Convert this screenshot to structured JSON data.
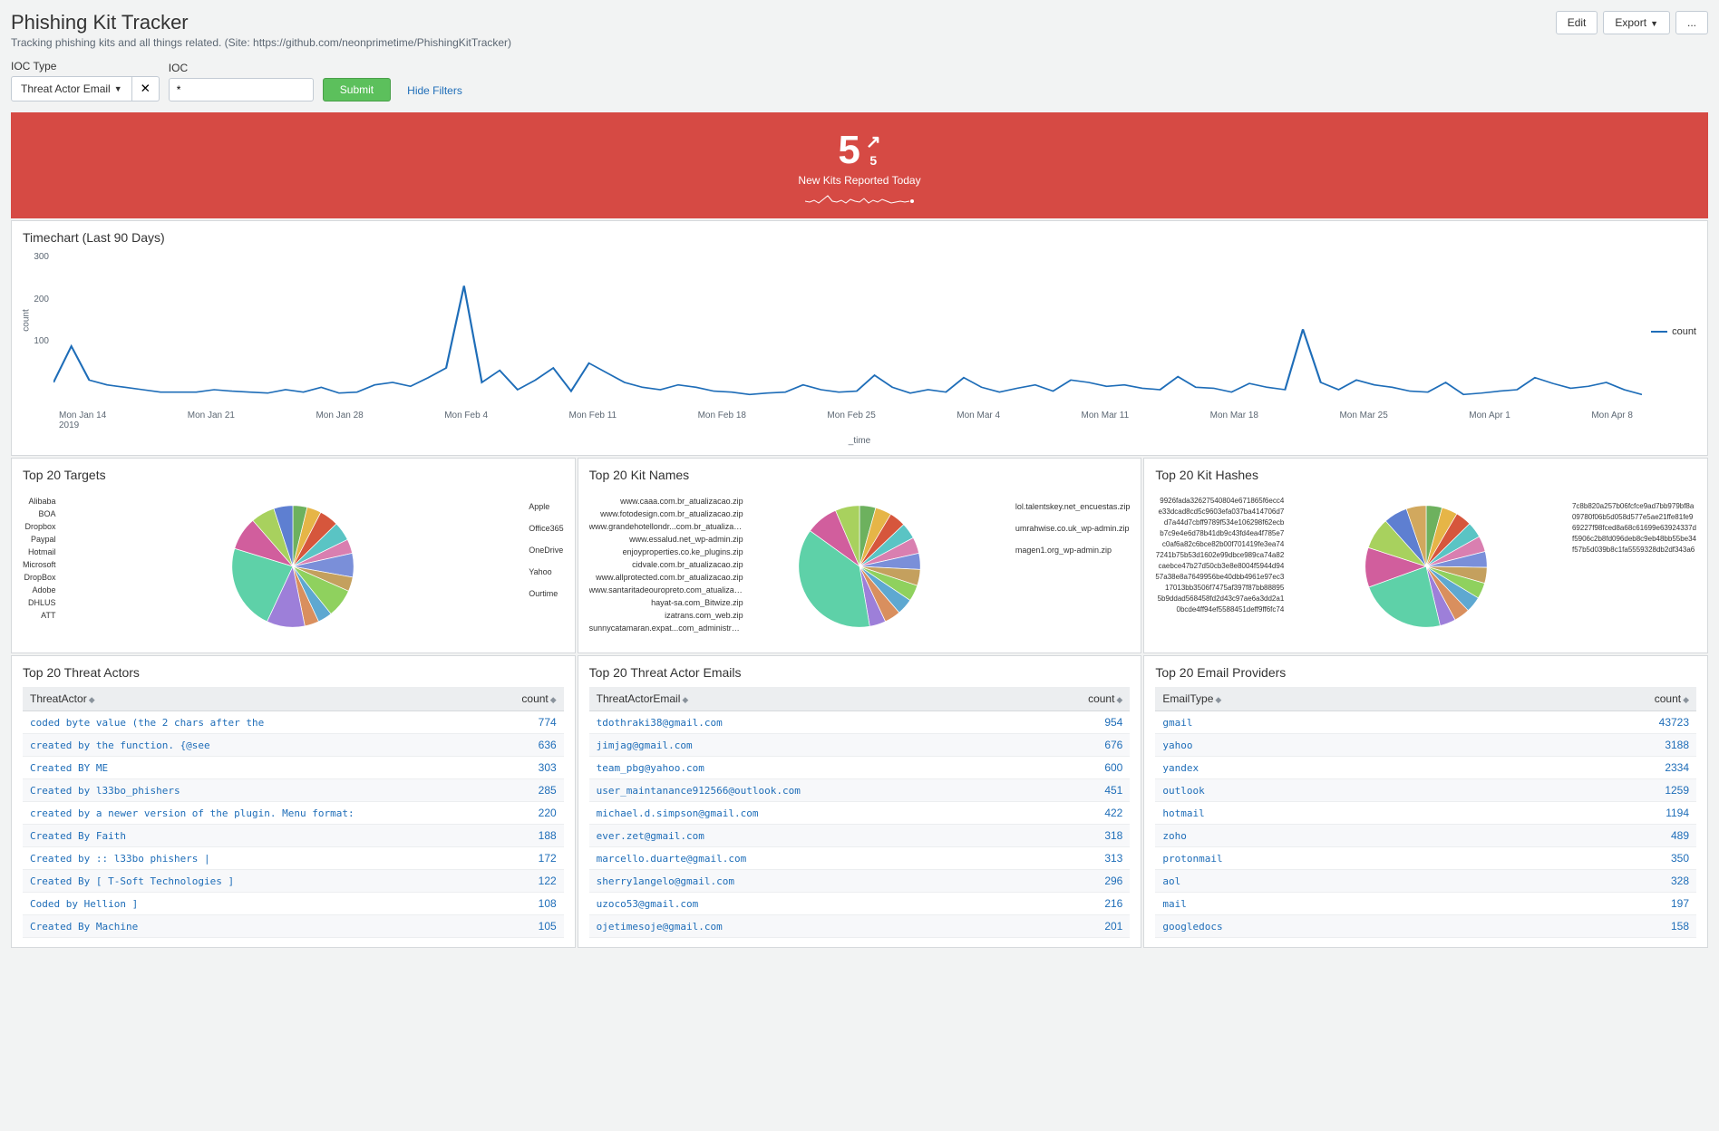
{
  "header": {
    "title": "Phishing Kit Tracker",
    "subtitle": "Tracking phishing kits and all things related. (Site: https://github.com/neonprimetime/PhishingKitTracker)",
    "buttons": {
      "edit": "Edit",
      "export": "Export",
      "more": "..."
    }
  },
  "filters": {
    "ioc_type_label": "IOC Type",
    "ioc_type_value": "Threat Actor Email",
    "ioc_label": "IOC",
    "ioc_value": "*",
    "submit": "Submit",
    "hide_filters": "Hide Filters"
  },
  "banner": {
    "value": "5",
    "delta": "5",
    "label": "New Kits Reported Today"
  },
  "timechart": {
    "title": "Timechart (Last 90 Days)",
    "y_label": "count",
    "y_ticks": [
      "300",
      "200",
      "100"
    ],
    "x_label": "_time",
    "x_ticks": [
      "Mon Jan 14",
      "Mon Jan 21",
      "Mon Jan 28",
      "Mon Feb 4",
      "Mon Feb 11",
      "Mon Feb 18",
      "Mon Feb 25",
      "Mon Mar 4",
      "Mon Mar 11",
      "Mon Mar 18",
      "Mon Mar 25",
      "Mon Apr 1",
      "Mon Apr 8"
    ],
    "x_year": "2019",
    "legend": "count"
  },
  "pies": {
    "targets": {
      "title": "Top 20 Targets",
      "left": [
        "Alibaba",
        "BOA",
        "Dropbox",
        "Paypal",
        "Hotmail",
        "Microsoft",
        "DropBox",
        "Adobe",
        "DHLUS",
        "ATT"
      ],
      "right": [
        "Apple",
        "Office365",
        "OneDrive",
        "Yahoo",
        "Ourtime"
      ]
    },
    "kitnames": {
      "title": "Top 20 Kit Names",
      "left": [
        "www.caaa.com.br_atualizacao.zip",
        "www.fotodesign.com.br_atualizacao.zip",
        "www.grandehotellondr...com.br_atualizacao.zip",
        "www.essalud.net_wp-admin.zip",
        "enjoyproperties.co.ke_plugins.zip",
        "cidvale.com.br_atualizacao.zip",
        "www.allprotected.com.br_atualizacao.zip",
        "www.santaritadeouropreto.com_atualizacao.zip",
        "hayat-sa.com_Bitwize.zip",
        "izatrans.com_web.zip",
        "sunnycatamaran.expat...com_administrator.zip"
      ],
      "right": [
        "lol.talentskey.net_encuestas.zip",
        "umrahwise.co.uk_wp-admin.zip",
        "magen1.org_wp-admin.zip"
      ]
    },
    "hashes": {
      "title": "Top 20 Kit Hashes",
      "left": [
        "9926fada32627540804e671865f6ecc4",
        "e33dcad8cd5c9603efa037ba414706d7",
        "d7a44d7cbff9789f534e106298f62ecb",
        "b7c9e4e6d78b41db9c43fd4ea4f785e7",
        "c0af6a82c6bce82b00f701419fe3ea74",
        "7241b75b53d1602e99dbce989ca74a82",
        "caebce47b27d50cb3e8e8004f5944d94",
        "57a38e8a7649956be40dbb4961e97ec3",
        "17013bb3506f7475af397f87bb88895",
        "5b9ddad568458fd2d43c97ae6a3dd2a1",
        "0bcde4ff94ef5588451deff9ff6fc74"
      ],
      "right": [
        "7c8b820a257b06fcfce9ad7bb979bf8a",
        "09780f06b5d058d577e5ae21ffe81fe9",
        "69227f98fced8a68c61699e63924337d",
        "f5906c2b8fd096deb8c9eb48bb55be34",
        "f57b5d039b8c1fa5559328db2df343a6"
      ]
    }
  },
  "tables": {
    "actors": {
      "title": "Top 20 Threat Actors",
      "col1": "ThreatActor",
      "col2": "count",
      "rows": [
        {
          "a": "coded byte value (the 2 chars after the",
          "c": "774"
        },
        {
          "a": "created by the function. {@see",
          "c": "636"
        },
        {
          "a": "Created BY ME",
          "c": "303"
        },
        {
          "a": "Created by l33bo_phishers",
          "c": "285"
        },
        {
          "a": "created by a newer version of the plugin. Menu format:",
          "c": "220"
        },
        {
          "a": "Created By Faith",
          "c": "188"
        },
        {
          "a": "Created by :: l33bo phishers   |",
          "c": "172"
        },
        {
          "a": "Created By [ T-Soft Technologies ]",
          "c": "122"
        },
        {
          "a": "Coded by Hellion ]",
          "c": "108"
        },
        {
          "a": "Created By Machine",
          "c": "105"
        }
      ]
    },
    "emails": {
      "title": "Top 20 Threat Actor Emails",
      "col1": "ThreatActorEmail",
      "col2": "count",
      "rows": [
        {
          "a": "tdothraki38@gmail.com",
          "c": "954"
        },
        {
          "a": "jimjag@gmail.com",
          "c": "676"
        },
        {
          "a": "team_pbg@yahoo.com",
          "c": "600"
        },
        {
          "a": "user_maintanance912566@outlook.com",
          "c": "451"
        },
        {
          "a": "michael.d.simpson@gmail.com",
          "c": "422"
        },
        {
          "a": "ever.zet@gmail.com",
          "c": "318"
        },
        {
          "a": "marcello.duarte@gmail.com",
          "c": "313"
        },
        {
          "a": "sherry1angelo@gmail.com",
          "c": "296"
        },
        {
          "a": "uzoco53@gmail.com",
          "c": "216"
        },
        {
          "a": "ojetimesoje@gmail.com",
          "c": "201"
        }
      ]
    },
    "providers": {
      "title": "Top 20 Email Providers",
      "col1": "EmailType",
      "col2": "count",
      "rows": [
        {
          "a": "gmail",
          "c": "43723"
        },
        {
          "a": "yahoo",
          "c": "3188"
        },
        {
          "a": "yandex",
          "c": "2334"
        },
        {
          "a": "outlook",
          "c": "1259"
        },
        {
          "a": "hotmail",
          "c": "1194"
        },
        {
          "a": "zoho",
          "c": "489"
        },
        {
          "a": "protonmail",
          "c": "350"
        },
        {
          "a": "aol",
          "c": "328"
        },
        {
          "a": "mail",
          "c": "197"
        },
        {
          "a": "googledocs",
          "c": "158"
        }
      ]
    }
  },
  "chart_data": [
    {
      "type": "line",
      "title": "Timechart (Last 90 Days)",
      "xlabel": "_time",
      "ylabel": "count",
      "ylim": [
        0,
        300
      ],
      "x_tick_labels": [
        "Mon Jan 14 2019",
        "Mon Jan 21",
        "Mon Jan 28",
        "Mon Feb 4",
        "Mon Feb 11",
        "Mon Feb 18",
        "Mon Feb 25",
        "Mon Mar 4",
        "Mon Mar 11",
        "Mon Mar 18",
        "Mon Mar 25",
        "Mon Apr 1",
        "Mon Apr 8"
      ],
      "series": [
        {
          "name": "count",
          "values": [
            30,
            105,
            35,
            25,
            20,
            15,
            10,
            10,
            10,
            15,
            12,
            10,
            8,
            15,
            10,
            20,
            8,
            10,
            25,
            30,
            22,
            40,
            60,
            230,
            30,
            55,
            15,
            35,
            60,
            12,
            70,
            50,
            30,
            20,
            15,
            25,
            20,
            12,
            10,
            5,
            8,
            10,
            25,
            15,
            10,
            12,
            45,
            20,
            8,
            15,
            10,
            40,
            20,
            10,
            18,
            25,
            12,
            35,
            30,
            22,
            25,
            18,
            15,
            42,
            20,
            18,
            10,
            28,
            20,
            15,
            140,
            30,
            15,
            35,
            25,
            20,
            12,
            10,
            30,
            5,
            8,
            12,
            15,
            40,
            28,
            18,
            22,
            30,
            15,
            5
          ]
        }
      ]
    },
    {
      "type": "pie",
      "title": "Top 20 Targets",
      "categories": [
        "Alibaba",
        "BOA",
        "Dropbox",
        "Paypal",
        "Hotmail",
        "Microsoft",
        "DropBox",
        "Adobe",
        "DHLUS",
        "ATT",
        "Apple",
        "Office365",
        "OneDrive",
        "Yahoo",
        "Ourtime"
      ],
      "values": [
        3,
        3,
        4,
        4,
        3,
        5,
        3,
        6,
        3,
        3,
        8,
        18,
        7,
        5,
        4
      ]
    },
    {
      "type": "pie",
      "title": "Top 20 Kit Names",
      "categories": [
        "www.caaa.com.br_atualizacao.zip",
        "www.fotodesign.com.br_atualizacao.zip",
        "www.grandehotellondr...com.br_atualizacao.zip",
        "www.essalud.net_wp-admin.zip",
        "enjoyproperties.co.ke_plugins.zip",
        "cidvale.com.br_atualizacao.zip",
        "www.allprotected.com.br_atualizacao.zip",
        "www.santaritadeouropreto.com_atualizacao.zip",
        "hayat-sa.com_Bitwize.zip",
        "izatrans.com_web.zip",
        "sunnycatamaran.expat...com_administrator.zip",
        "lol.talentskey.net_encuestas.zip",
        "umrahwise.co.uk_wp-admin.zip",
        "magen1.org_wp-admin.zip"
      ],
      "values": [
        4,
        4,
        4,
        4,
        4,
        4,
        4,
        4,
        4,
        4,
        4,
        35,
        8,
        6
      ]
    },
    {
      "type": "pie",
      "title": "Top 20 Kit Hashes",
      "categories": [
        "9926fada32627540804e671865f6ecc4",
        "e33dcad8cd5c9603efa037ba414706d7",
        "d7a44d7cbff9789f534e106298f62ecb",
        "b7c9e4e6d78b41db9c43fd4ea4f785e7",
        "c0af6a82c6bce82b00f701419fe3ea74",
        "7241b75b53d1602e99dbce989ca74a82",
        "caebce47b27d50cb3e8e8004f5944d94",
        "57a38e8a7649956be40dbb4961e97ec3",
        "17013bb3506f7475af397f87bb88895",
        "5b9ddad568458fd2d43c97ae6a3dd2a1",
        "0bcde4ff94ef5588451deff9ff6fc74",
        "7c8b820a257b06fcfce9ad7bb979bf8a",
        "09780f06b5d058d577e5ae21ffe81fe9",
        "69227f98fced8a68c61699e63924337d",
        "f5906c2b8fd096deb8c9eb48bb55be34",
        "f57b5d039b8c1fa5559328db2df343a6"
      ],
      "values": [
        4,
        4,
        4,
        4,
        4,
        4,
        4,
        4,
        4,
        4,
        4,
        22,
        10,
        8,
        6,
        5
      ]
    }
  ]
}
